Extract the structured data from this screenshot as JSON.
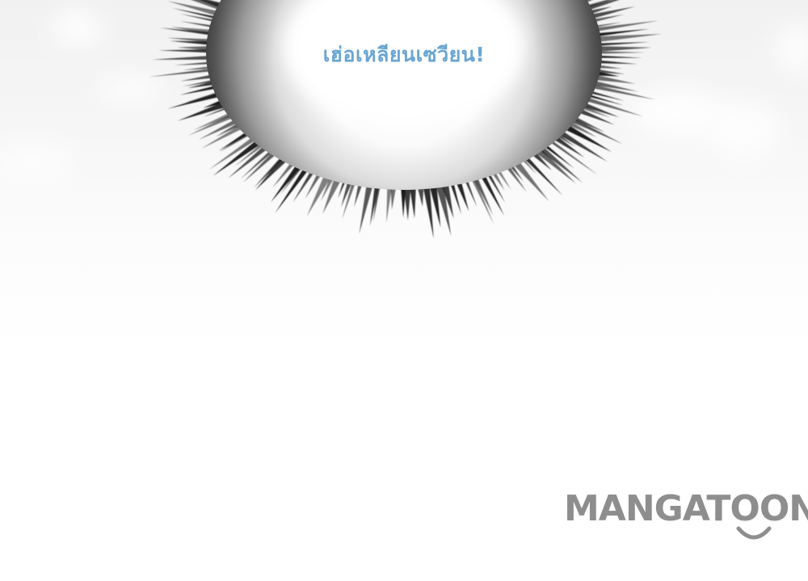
{
  "panel": {
    "speech_text": "เฮ่อเหลียนเซวียน!",
    "speech_color": "#6aa5d2",
    "burst_color": "#1e1e1e",
    "background_color": "#ffffff"
  },
  "watermark": {
    "text": "MANGATOON",
    "color": "#8e8e8e",
    "icon": "smile-icon"
  }
}
